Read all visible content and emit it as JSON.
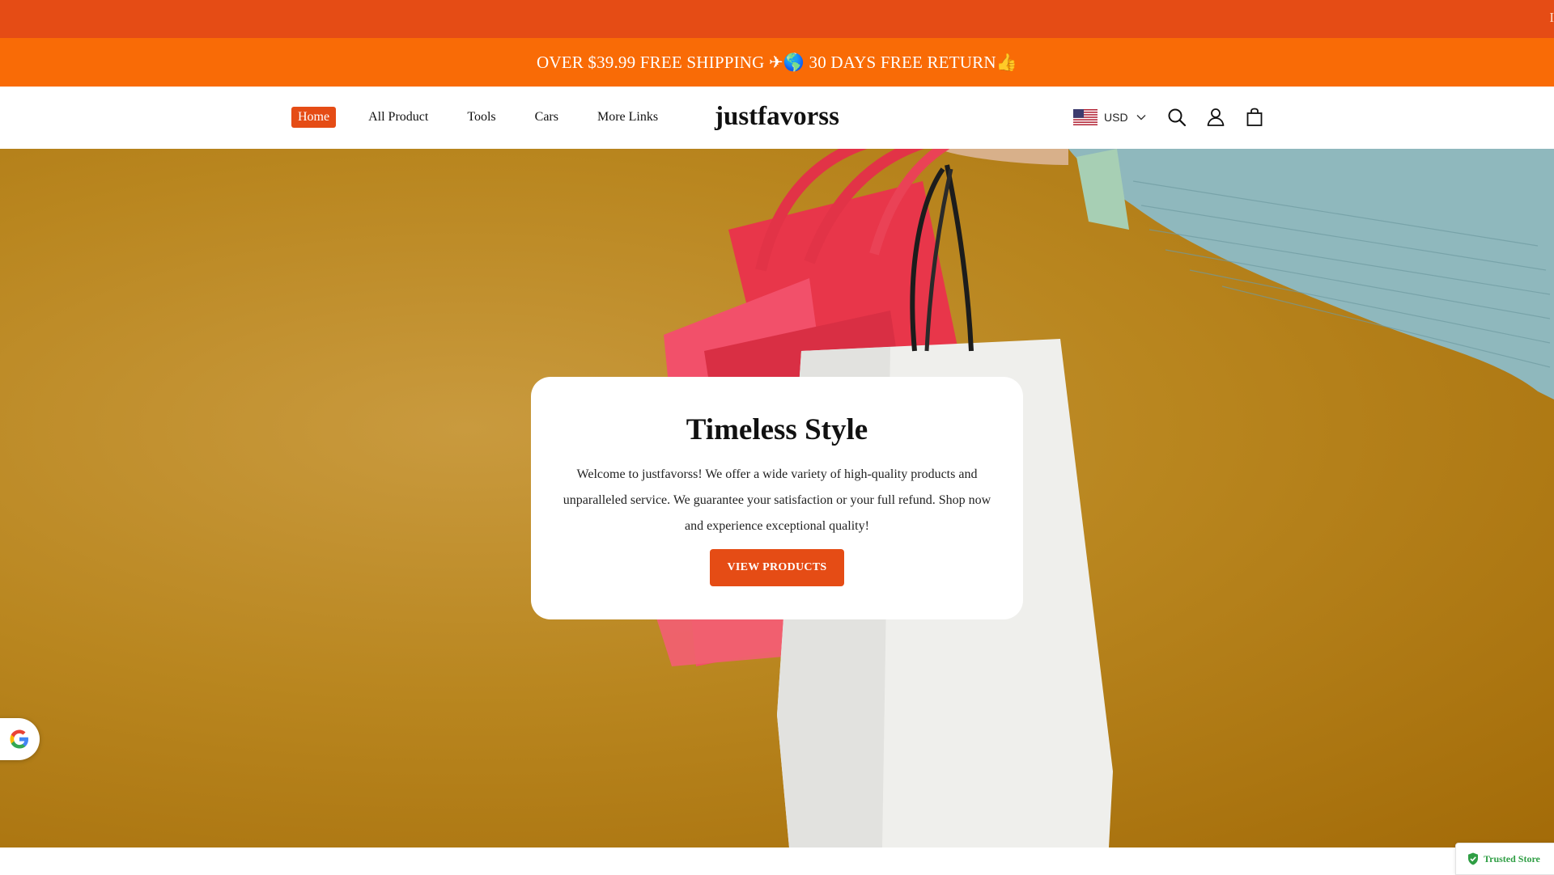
{
  "top_strip": {
    "text": "I"
  },
  "announcement": {
    "text": "OVER $39.99 FREE SHIPPING ✈🌎 30 DAYS FREE RETURN👍"
  },
  "header": {
    "nav": [
      {
        "label": "Home",
        "active": true
      },
      {
        "label": "All Product"
      },
      {
        "label": "Tools"
      },
      {
        "label": "Cars"
      },
      {
        "label": "More Links"
      }
    ],
    "logo": "justfavorss",
    "currency": {
      "code": "USD",
      "flag_icon": "us-flag-icon"
    },
    "icons": [
      "search-icon",
      "account-icon",
      "cart-icon"
    ]
  },
  "hero": {
    "title": "Timeless Style",
    "body": "Welcome to justfavorss! We offer a wide variety of high-quality products and unparalleled service. We guarantee your satisfaction or your full refund. Shop now and experience exceptional quality!",
    "cta": "VIEW PRODUCTS"
  },
  "badges": {
    "google": "google-icon",
    "trusted_store": "Trusted Store"
  },
  "colors": {
    "accent": "#e54c15",
    "announcement_bg": "#f96b06",
    "hero_bg": "#b9861f",
    "trusted_green": "#2f9e44"
  }
}
